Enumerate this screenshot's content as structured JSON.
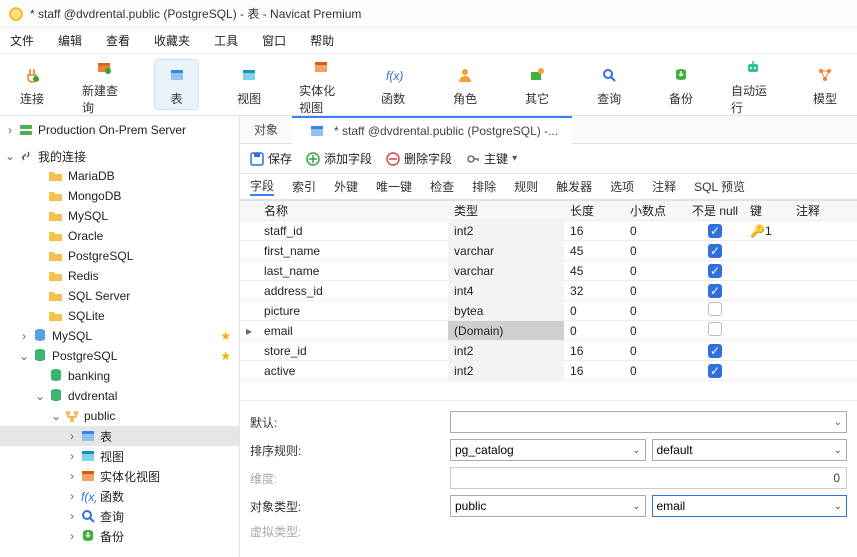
{
  "title": "* staff @dvdrental.public (PostgreSQL) - 表 - Navicat Premium",
  "menu": [
    "文件",
    "编辑",
    "查看",
    "收藏夹",
    "工具",
    "窗口",
    "帮助"
  ],
  "ribbon": [
    {
      "label": "连接",
      "icon": "plug"
    },
    {
      "label": "新建查询",
      "icon": "query"
    },
    {
      "label": "表",
      "icon": "table",
      "active": true
    },
    {
      "label": "视图",
      "icon": "view"
    },
    {
      "label": "实体化视图",
      "icon": "mview"
    },
    {
      "label": "函数",
      "icon": "fx"
    },
    {
      "label": "角色",
      "icon": "user"
    },
    {
      "label": "其它",
      "icon": "other"
    },
    {
      "label": "查询",
      "icon": "search"
    },
    {
      "label": "备份",
      "icon": "backup"
    },
    {
      "label": "自动运行",
      "icon": "robot"
    },
    {
      "label": "模型",
      "icon": "model"
    }
  ],
  "sidebar_header": {
    "label": "Production On-Prem Server"
  },
  "sidebar_myconn": "我的连接",
  "sidebar_items": [
    {
      "label": "MariaDB",
      "icon": "folder",
      "ind": 2
    },
    {
      "label": "MongoDB",
      "icon": "folder",
      "ind": 2
    },
    {
      "label": "MySQL",
      "icon": "folder",
      "ind": 2
    },
    {
      "label": "Oracle",
      "icon": "folder",
      "ind": 2
    },
    {
      "label": "PostgreSQL",
      "icon": "folder",
      "ind": 2
    },
    {
      "label": "Redis",
      "icon": "folder",
      "ind": 2
    },
    {
      "label": "SQL Server",
      "icon": "folder",
      "ind": 2
    },
    {
      "label": "SQLite",
      "icon": "folder",
      "ind": 2
    },
    {
      "label": "MySQL",
      "icon": "db",
      "ind": 1,
      "star": true,
      "fold": ">"
    },
    {
      "label": "PostgreSQL",
      "icon": "dbg",
      "ind": 1,
      "star": true,
      "fold": "v"
    },
    {
      "label": "banking",
      "icon": "dbcyl",
      "ind": 2,
      "fold": ""
    },
    {
      "label": "dvdrental",
      "icon": "dbcyl",
      "ind": 2,
      "fold": "v"
    },
    {
      "label": "public",
      "icon": "schema",
      "ind": 3,
      "fold": "v"
    },
    {
      "label": "表",
      "icon": "tableblue",
      "ind": 4,
      "fold": ">",
      "sel": true
    },
    {
      "label": "视图",
      "icon": "view",
      "ind": 4,
      "fold": ">"
    },
    {
      "label": "实体化视图",
      "icon": "mview",
      "ind": 4,
      "fold": ">"
    },
    {
      "label": "函数",
      "icon": "fx",
      "ind": 4,
      "fold": ">"
    },
    {
      "label": "查询",
      "icon": "search",
      "ind": 4,
      "fold": ">"
    },
    {
      "label": "备份",
      "icon": "backup",
      "ind": 4,
      "fold": ">"
    }
  ],
  "content_tabs": [
    {
      "label": "对象",
      "active": false
    },
    {
      "label": "* staff @dvdrental.public (PostgreSQL) -...",
      "active": true
    }
  ],
  "toolbar": {
    "save": "保存",
    "add": "添加字段",
    "del": "删除字段",
    "pk": "主键",
    "pk_arrow": "▾"
  },
  "inner_tabs": [
    "字段",
    "索引",
    "外键",
    "唯一键",
    "检查",
    "排除",
    "规则",
    "触发器",
    "选项",
    "注释",
    "SQL 预览"
  ],
  "inner_sel": 0,
  "grid_headers": {
    "name": "名称",
    "type": "类型",
    "len": "长度",
    "dec": "小数点",
    "notnull": "不是 null",
    "key": "键",
    "comment": "注释"
  },
  "rows": [
    {
      "name": "staff_id",
      "type": "int2",
      "len": "16",
      "dec": "0",
      "nn": true,
      "key": "1"
    },
    {
      "name": "first_name",
      "type": "varchar",
      "len": "45",
      "dec": "0",
      "nn": true
    },
    {
      "name": "last_name",
      "type": "varchar",
      "len": "45",
      "dec": "0",
      "nn": true
    },
    {
      "name": "address_id",
      "type": "int4",
      "len": "32",
      "dec": "0",
      "nn": true
    },
    {
      "name": "picture",
      "type": "bytea",
      "len": "0",
      "dec": "0",
      "nn": false
    },
    {
      "name": "email",
      "type": "(Domain)",
      "len": "0",
      "dec": "0",
      "nn": false,
      "sel": true,
      "ptr": true
    },
    {
      "name": "store_id",
      "type": "int2",
      "len": "16",
      "dec": "0",
      "nn": true
    },
    {
      "name": "active",
      "type": "int2",
      "len": "16",
      "dec": "0",
      "nn": true
    }
  ],
  "props": {
    "default_lbl": "默认:",
    "collate_lbl": "排序规则:",
    "collate_a": "pg_catalog",
    "collate_b": "default",
    "dim_lbl": "维度:",
    "dim_val": "0",
    "objtype_lbl": "对象类型:",
    "objtype_a": "public",
    "objtype_b": "email",
    "vtype_lbl": "虚拟类型:"
  }
}
